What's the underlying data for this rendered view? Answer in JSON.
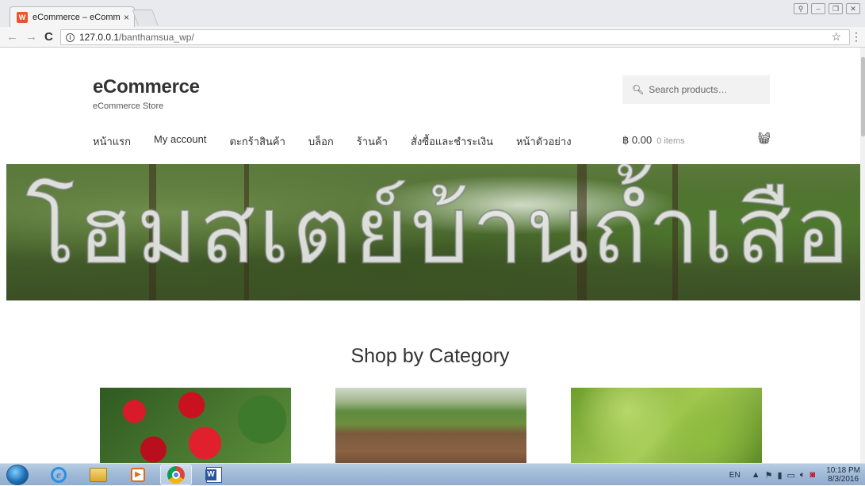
{
  "browser": {
    "tab_title": "eCommerce – eCommerce",
    "tab_close": "×",
    "url_host": "127.0.0.1",
    "url_path": "/banthamsua_wp/"
  },
  "site": {
    "title": "eCommerce",
    "description": "eCommerce Store",
    "search_placeholder": "Search products…",
    "nav": [
      "หน้าแรก",
      "My account",
      "ตะกร้าสินค้า",
      "บล็อก",
      "ร้านค้า",
      "สั่งซื้อและชำระเงิน",
      "หน้าตัวอย่าง"
    ],
    "cart_total": "฿ 0.00",
    "cart_count": "0 items",
    "hero_text": "โฮมสเตย์บ้านถ้ำเสือ",
    "section_title": "Shop by Category"
  },
  "taskbar": {
    "language": "EN",
    "time": "10:18 PM",
    "date": "8/3/2016"
  },
  "icons": {
    "colors": {
      "accent_blue": "#2b579a",
      "favicon": "#e8562f"
    }
  }
}
